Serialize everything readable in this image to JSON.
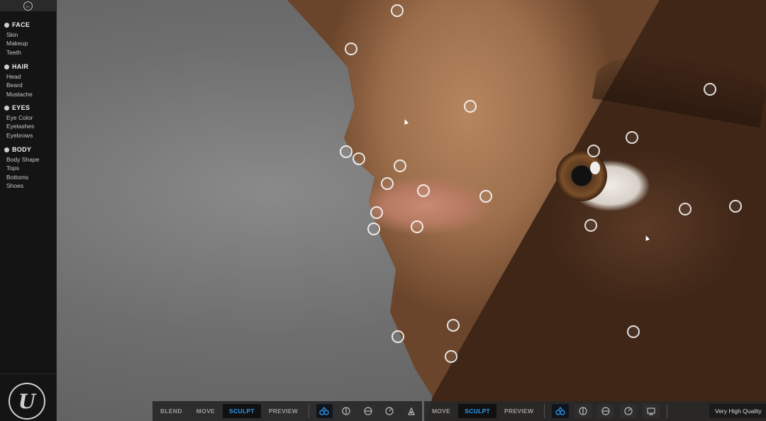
{
  "sidebar": {
    "sections": [
      {
        "title": "FACE",
        "icon": "face-icon",
        "items": [
          "Skin",
          "Makeup",
          "Teeth"
        ]
      },
      {
        "title": "HAIR",
        "icon": "hair-icon",
        "items": [
          "Head",
          "Beard",
          "Mustache"
        ]
      },
      {
        "title": "EYES",
        "icon": "eye-icon",
        "items": [
          "Eye Color",
          "Eyelashes",
          "Eyebrows"
        ]
      },
      {
        "title": "BODY",
        "icon": "body-icon",
        "items": [
          "Body Shape",
          "Tops",
          "Bottoms",
          "Shoes"
        ]
      }
    ],
    "back_icon": "back-arrow-icon",
    "logo_icon": "unreal-engine-logo-icon"
  },
  "toolbar_left": {
    "modes": [
      "BLEND",
      "MOVE",
      "SCULPT",
      "PREVIEW"
    ],
    "active_mode": "SCULPT",
    "tools": [
      "symmetry-icon",
      "face-front-icon",
      "face-side-icon",
      "face-profile-icon",
      "head-icon"
    ]
  },
  "toolbar_right": {
    "modes": [
      "MOVE",
      "SCULPT",
      "PREVIEW"
    ],
    "active_mode": "SCULPT",
    "tools": [
      "symmetry-icon",
      "face-front-icon",
      "face-side-icon",
      "face-profile-icon",
      "monitor-icon"
    ],
    "quality": "Very High Quality"
  },
  "colors": {
    "accent": "#2d9bf0",
    "sidebar_bg": "#141414"
  }
}
